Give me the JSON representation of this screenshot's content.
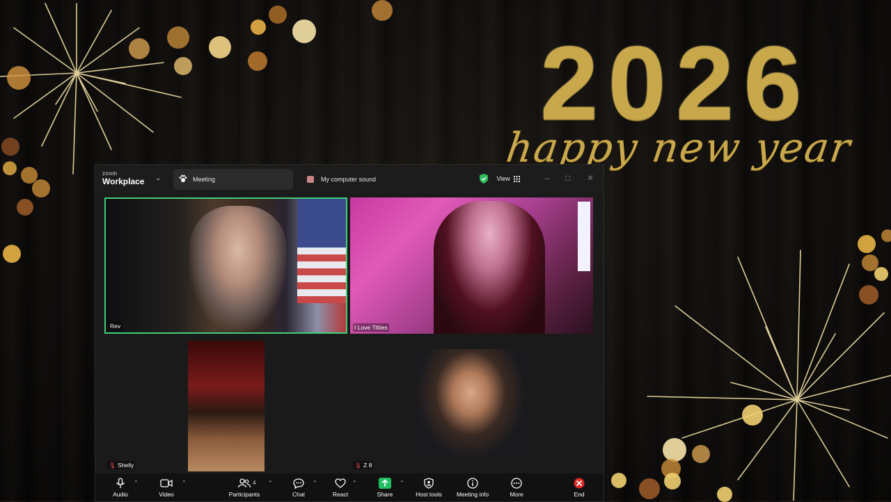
{
  "background": {
    "year": "2026",
    "greeting": "happy new year",
    "accent_color": "#c9a84b"
  },
  "window": {
    "brand_small": "zoom",
    "brand_big": "Workplace",
    "tabs": [
      {
        "label": "Meeting",
        "icon": "paw-icon"
      },
      {
        "label": "My computer sound",
        "icon": "computer-sound-icon"
      }
    ],
    "view_label": "View",
    "security_color": "#2dbb5a"
  },
  "participants": [
    {
      "name": "Rev",
      "active_speaker": true,
      "muted": false
    },
    {
      "name": "I Love Titties",
      "active_speaker": false,
      "muted": false
    },
    {
      "name": "Shelly",
      "active_speaker": false,
      "muted": true
    },
    {
      "name": "Z 8",
      "active_speaker": false,
      "muted": true
    }
  ],
  "toolbar": {
    "audio": "Audio",
    "video": "Video",
    "participants": "Participants",
    "participants_count": "4",
    "chat": "Chat",
    "react": "React",
    "share": "Share",
    "host_tools": "Host tools",
    "meeting_info": "Meeting info",
    "more": "More",
    "end": "End",
    "share_color": "#1fbf62",
    "end_color": "#e02828"
  }
}
